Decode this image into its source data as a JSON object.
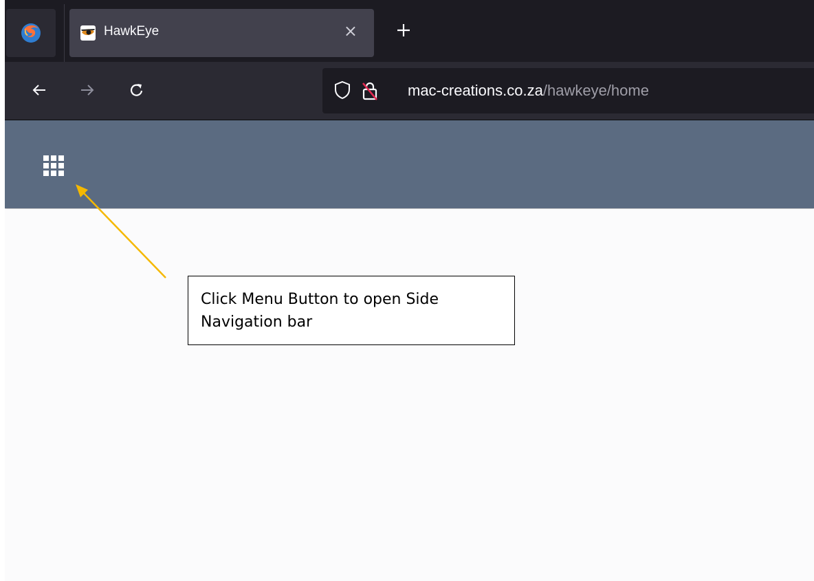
{
  "browser": {
    "tab": {
      "title": "HawkEye",
      "favicon": "hawk-eye-favicon",
      "close_glyph": "×"
    },
    "new_tab_glyph": "+",
    "url": {
      "host": "mac-creations.co.za",
      "path": "/hawkeye/home"
    },
    "icons": {
      "app_menu": "firefox-icon",
      "back": "arrow-left-icon",
      "forward": "arrow-right-icon",
      "reload": "reload-icon",
      "tracking_protection": "shield-icon",
      "insecure": "insecure-lock-icon"
    }
  },
  "app": {
    "header_color": "#5b6b81",
    "menu_button_icon": "apps-grid-icon"
  },
  "annotation": {
    "text": "Click Menu Button to open Side Navigation bar",
    "arrow_color": "#f5b800"
  }
}
